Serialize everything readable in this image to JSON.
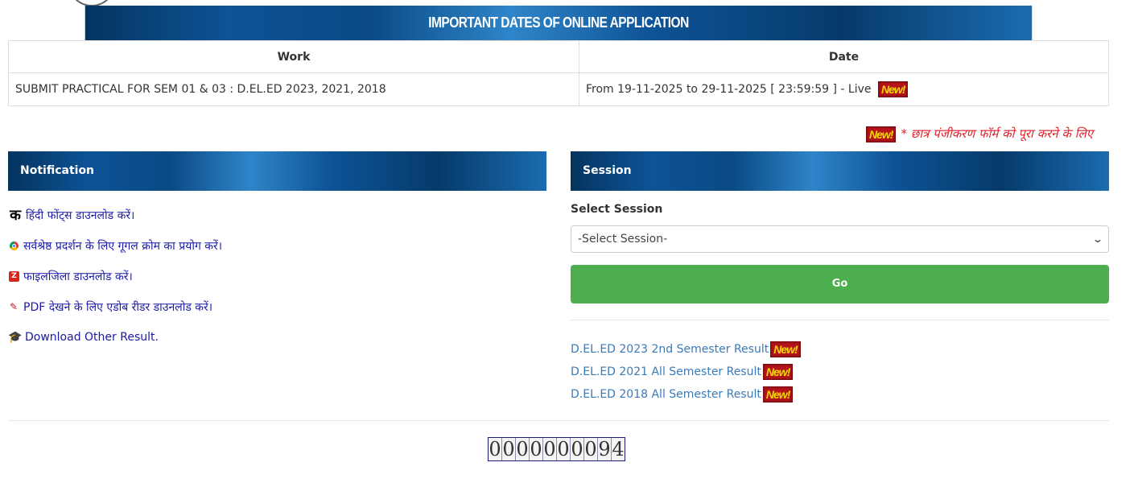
{
  "important_dates": {
    "title": "IMPORTANT DATES OF ONLINE APPLICATION",
    "columns": [
      "Work",
      "Date"
    ],
    "rows": [
      {
        "work": "SUBMIT PRACTICAL FOR SEM 01 & 03 : D.EL.ED 2023, 2021, 2018",
        "date": "From 19-11-2025 to 29-11-2025 [ 23:59:59 ] - Live"
      }
    ]
  },
  "new_badge_label": "New!",
  "marquee_text": "* छात्र पंजीकरण फॉर्म को पूरा करने के लिए",
  "notification": {
    "heading": "Notification",
    "icon_ka": "क",
    "items": [
      {
        "text": "हिंदी फोंट्स डाउनलोड करें।",
        "icon": "hindi-font-icon"
      },
      {
        "text": "सर्वश्रेष्ठ प्रदर्शन के लिए गूगल क्रोम का प्रयोग करें।",
        "icon": "chrome-icon"
      },
      {
        "text": "फाइलजिला डाउनलोड करें।",
        "icon": "filezilla-icon"
      },
      {
        "text": "PDF देखने के लिए एडोब रीडर डाउनलोड करें।",
        "icon": "adobe-pdf-icon"
      },
      {
        "text": "Download Other Result.",
        "icon": "graduation-cap-icon"
      }
    ]
  },
  "session": {
    "heading": "Session",
    "label": "Select Session",
    "selected": "-Select Session-",
    "go_label": "Go",
    "results": [
      "D.EL.ED 2023 2nd Semester Result",
      "D.EL.ED 2021 All Semester Result",
      "D.EL.ED 2018 All Semester Result"
    ]
  },
  "visitor_counter": "0000000094",
  "colors": {
    "banner_dark": "#05345f",
    "go_button": "#4cae4f",
    "link": "#3a7ab7",
    "notification_link": "#1a1aa6",
    "alert_red": "#e0212b"
  }
}
